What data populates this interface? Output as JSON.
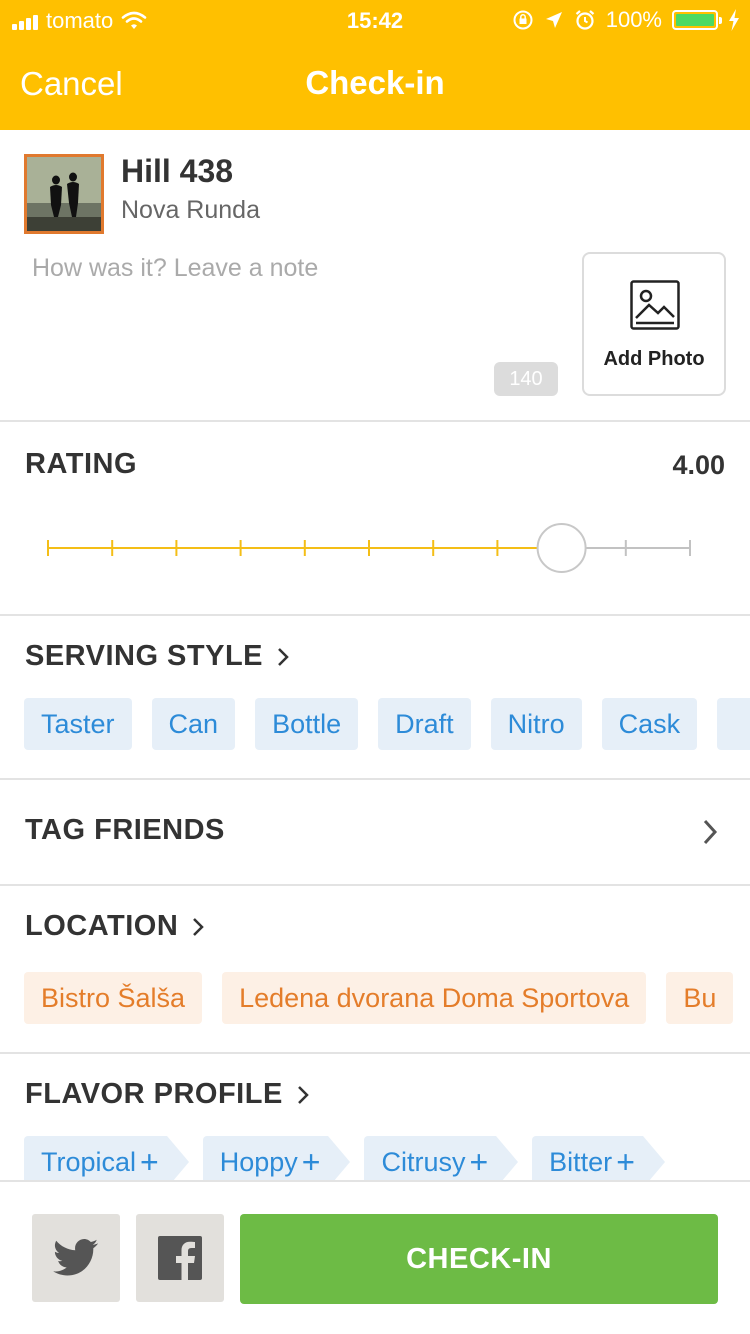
{
  "status_bar": {
    "carrier": "tomato",
    "time": "15:42",
    "battery": "100%",
    "battery_level": 1.0
  },
  "nav": {
    "cancel_label": "Cancel",
    "title": "Check-in"
  },
  "beer": {
    "name": "Hill 438",
    "brewery": "Nova Runda",
    "note_placeholder": "How was it? Leave a note",
    "char_count": "140",
    "add_photo_label": "Add Photo"
  },
  "rating": {
    "title": "RATING",
    "value_text": "4.00",
    "value": 4.0,
    "min": 0,
    "max": 5
  },
  "serving_style": {
    "title": "SERVING STYLE",
    "options": [
      "Taster",
      "Can",
      "Bottle",
      "Draft",
      "Nitro",
      "Cask"
    ]
  },
  "tag_friends": {
    "title": "TAG FRIENDS"
  },
  "location": {
    "title": "LOCATION",
    "options": [
      "Bistro Šalša",
      "Ledena dvorana Doma Sportova",
      "Bu"
    ]
  },
  "flavor_profile": {
    "title": "FLAVOR PROFILE",
    "tags": [
      "Tropical",
      "Hoppy",
      "Citrusy",
      "Bitter"
    ]
  },
  "footer": {
    "checkin_label": "CHECK-IN"
  },
  "colors": {
    "header": "#FFC000",
    "slider_active": "#F4BE17",
    "chip_blue": "#2D8BD8",
    "chip_orange": "#E47D2A",
    "checkin_green": "#6DBB45"
  }
}
